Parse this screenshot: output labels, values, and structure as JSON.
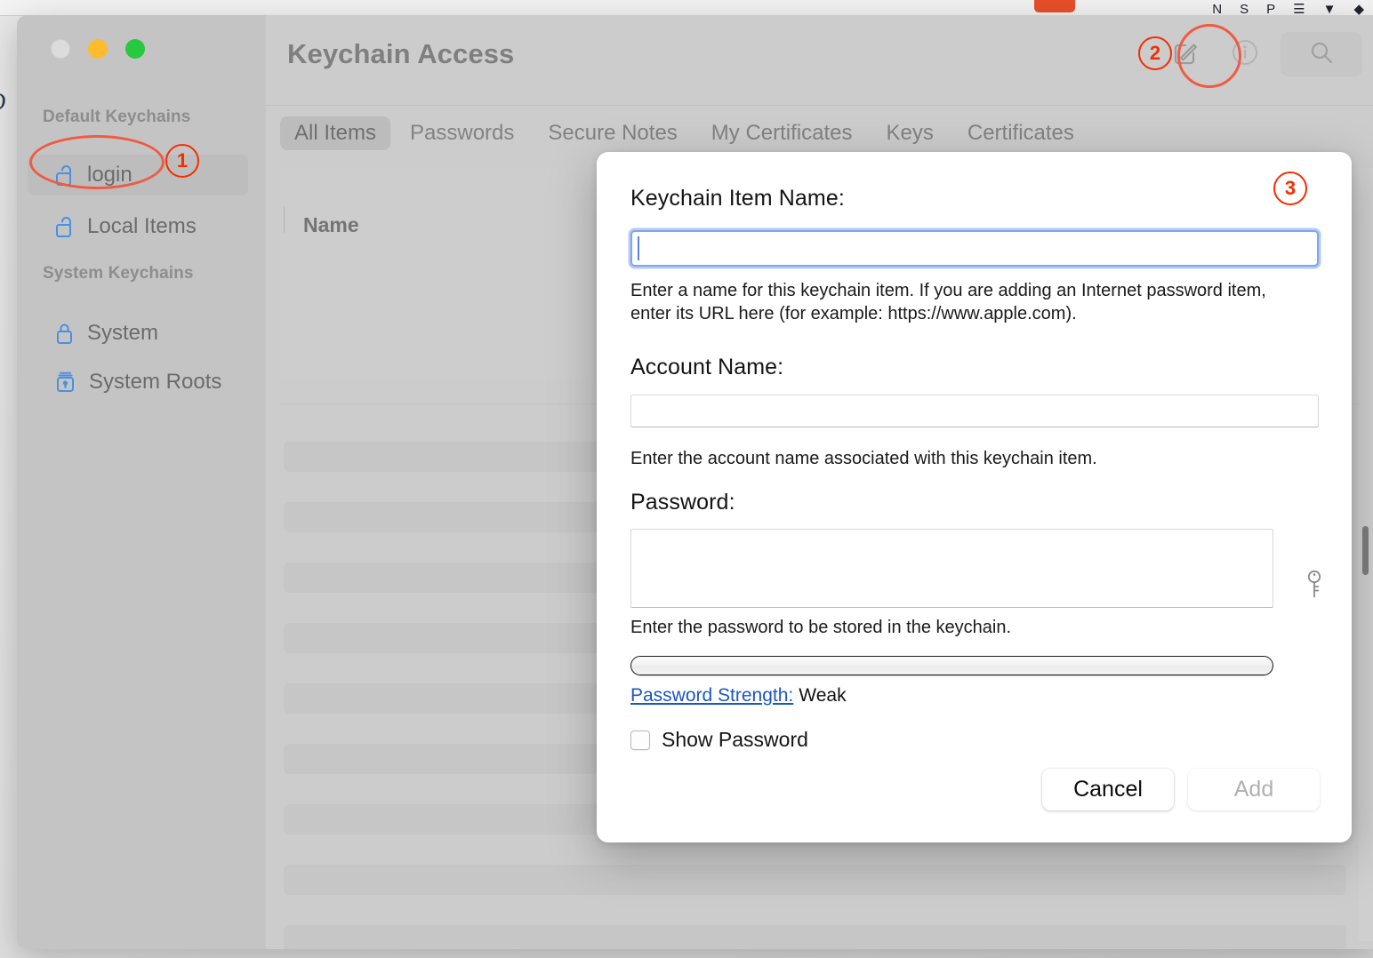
{
  "menubar": {
    "items": [
      "N",
      "S",
      "P",
      "☰",
      "▼",
      "◆"
    ]
  },
  "window": {
    "title": "Keychain Access"
  },
  "sidebar": {
    "sections": [
      {
        "title": "Default Keychains",
        "items": [
          {
            "label": "login",
            "icon": "unlocked-padlock-icon",
            "selected": true
          },
          {
            "label": "Local Items",
            "icon": "unlocked-padlock-icon",
            "selected": false
          }
        ]
      },
      {
        "title": "System Keychains",
        "items": [
          {
            "label": "System",
            "icon": "locked-padlock-icon",
            "selected": false
          },
          {
            "label": "System Roots",
            "icon": "certificate-padlock-icon",
            "selected": false
          }
        ]
      }
    ]
  },
  "toolbar": {
    "new_item_icon": "compose-square-pencil-icon",
    "info_icon": "info-circle-icon",
    "search_icon": "magnifier-icon"
  },
  "tabs": [
    {
      "label": "All Items",
      "active": true
    },
    {
      "label": "Passwords",
      "active": false
    },
    {
      "label": "Secure Notes",
      "active": false
    },
    {
      "label": "My Certificates",
      "active": false
    },
    {
      "label": "Keys",
      "active": false
    },
    {
      "label": "Certificates",
      "active": false
    }
  ],
  "list": {
    "columns": [
      "Name"
    ]
  },
  "dialog": {
    "name_label": "Keychain Item Name:",
    "name_value": "",
    "name_help": "Enter a name for this keychain item. If you are adding an Internet password item, enter its URL here (for example: https://www.apple.com).",
    "account_label": "Account Name:",
    "account_value": "",
    "account_help": "Enter the account name associated with this keychain item.",
    "password_label": "Password:",
    "password_value": "",
    "password_help": "Enter the password to be stored in the keychain.",
    "key_icon": "key-icon",
    "strength_percent": 0,
    "strength_link_label": "Password Strength:",
    "strength_value": "Weak",
    "show_password_label": "Show Password",
    "show_password_checked": false,
    "cancel_label": "Cancel",
    "add_label": "Add",
    "add_disabled": true
  },
  "annotations": [
    {
      "number": "①",
      "text": "1",
      "target": "sidebar-item-login"
    },
    {
      "number": "②",
      "text": "2",
      "target": "new-item-button"
    },
    {
      "number": "③",
      "text": "3",
      "target": "new-password-dialog"
    }
  ],
  "colors": {
    "annotation_red": "#f72d00",
    "annotation_ellipse": "#ef5b43",
    "focus_blue": "#7fa6f0",
    "link_blue": "#1a56c4",
    "sidebar_icon_blue": "#4a90e2"
  }
}
